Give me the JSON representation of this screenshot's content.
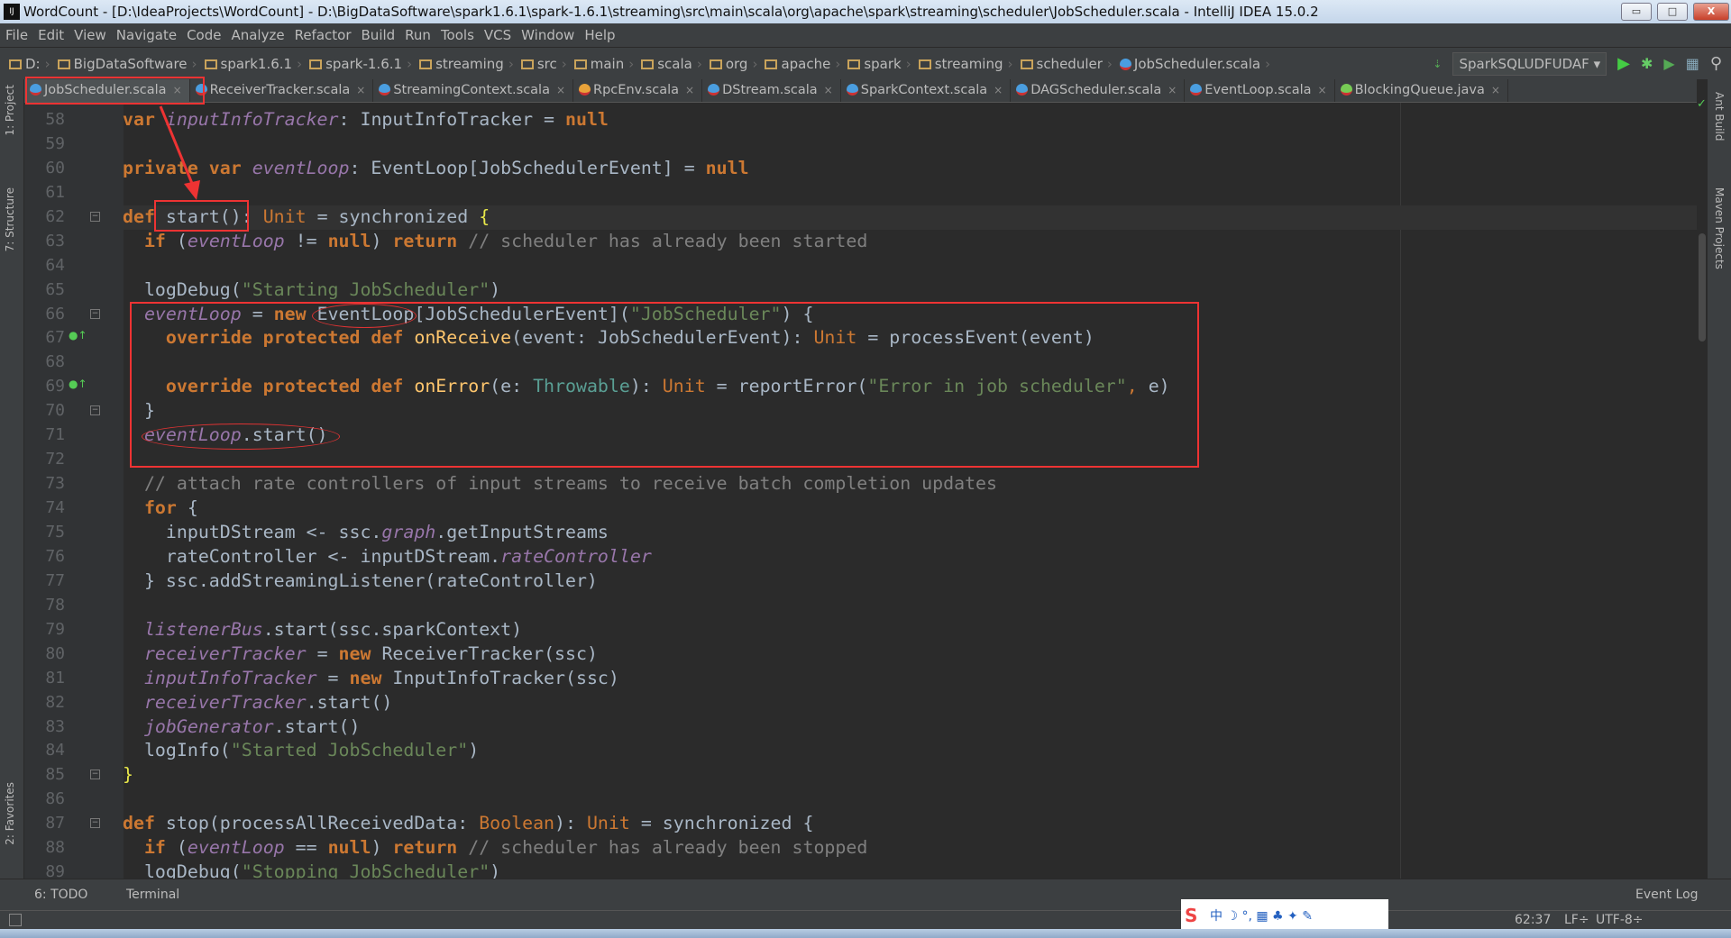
{
  "window": {
    "title": "WordCount - [D:\\IdeaProjects\\WordCount] - D:\\BigDataSoftware\\spark1.6.1\\spark-1.6.1\\streaming\\src\\main\\scala\\org\\apache\\spark\\streaming\\scheduler\\JobScheduler.scala - IntelliJ IDEA 15.0.2",
    "logo": "IJ",
    "minimize": "▭",
    "maximize": "□",
    "close": "X"
  },
  "menu": [
    "File",
    "Edit",
    "View",
    "Navigate",
    "Code",
    "Analyze",
    "Refactor",
    "Build",
    "Run",
    "Tools",
    "VCS",
    "Window",
    "Help"
  ],
  "breadcrumbs": [
    "D:",
    "BigDataSoftware",
    "spark1.6.1",
    "spark-1.6.1",
    "streaming",
    "src",
    "main",
    "scala",
    "org",
    "apache",
    "spark",
    "streaming",
    "scheduler",
    "JobScheduler.scala"
  ],
  "run_config": "SparkSQLUDFUDAF",
  "tabs": [
    {
      "label": "JobScheduler.scala",
      "active": true
    },
    {
      "label": "ReceiverTracker.scala"
    },
    {
      "label": "StreamingContext.scala"
    },
    {
      "label": "RpcEnv.scala"
    },
    {
      "label": "DStream.scala"
    },
    {
      "label": "SparkContext.scala"
    },
    {
      "label": "DAGScheduler.scala"
    },
    {
      "label": "EventLoop.scala"
    },
    {
      "label": "BlockingQueue.java"
    }
  ],
  "left_tools": [
    "1: Project",
    "7: Structure",
    "2: Favorites"
  ],
  "right_tools": [
    "Ant Build",
    "Maven Projects"
  ],
  "code": [
    {
      "n": "58",
      "t": [
        [
          "",
          "var ",
          "kw"
        ],
        [
          "inputInfoTracker",
          "fd"
        ],
        [
          ": InputInfoTracker = ",
          ""
        ],
        [
          "null",
          "kw"
        ]
      ]
    },
    {
      "n": "59",
      "t": []
    },
    {
      "n": "60",
      "t": [
        [
          "private var ",
          "kw"
        ],
        [
          "eventLoop",
          "fd"
        ],
        [
          ": EventLoop[JobSchedulerEvent] = ",
          ""
        ],
        [
          "null",
          "kw"
        ]
      ]
    },
    {
      "n": "61",
      "t": []
    },
    {
      "n": "62",
      "t": [
        [
          "def ",
          "kw"
        ],
        [
          "start",
          ""
        ],
        [
          "(): ",
          ""
        ],
        [
          "Unit",
          "ty"
        ],
        [
          " = synchronized ",
          ""
        ],
        [
          "{",
          "br"
        ]
      ]
    },
    {
      "n": "63",
      "t": [
        [
          "  if ",
          "kw"
        ],
        [
          "(",
          ""
        ],
        [
          "eventLoop",
          "fd"
        ],
        [
          " != ",
          ""
        ],
        [
          "null",
          "kw"
        ],
        [
          ") ",
          ""
        ],
        [
          "return",
          "kw"
        ],
        [
          " // scheduler has already been started",
          "cm"
        ]
      ]
    },
    {
      "n": "64",
      "t": []
    },
    {
      "n": "65",
      "t": [
        [
          "  logDebug(",
          ""
        ],
        [
          "\"Starting JobScheduler\"",
          "st"
        ],
        [
          ")",
          ""
        ]
      ]
    },
    {
      "n": "66",
      "t": [
        [
          "  ",
          ""
        ],
        [
          "eventLoop",
          "fd"
        ],
        [
          " = ",
          ""
        ],
        [
          "new ",
          "kw"
        ],
        [
          "EventLoop[JobSchedulerEvent](",
          ""
        ],
        [
          "\"JobScheduler\"",
          "st"
        ],
        [
          ") {",
          ""
        ]
      ]
    },
    {
      "n": "67",
      "t": [
        [
          "    override protected def ",
          "kw"
        ],
        [
          "onReceive",
          "fn"
        ],
        [
          "(event: JobSchedulerEvent): ",
          ""
        ],
        [
          "Unit",
          "ty"
        ],
        [
          " = processEvent(event)",
          ""
        ]
      ]
    },
    {
      "n": "68",
      "t": []
    },
    {
      "n": "69",
      "t": [
        [
          "    override protected def ",
          "kw"
        ],
        [
          "onError",
          "fn"
        ],
        [
          "(e: ",
          ""
        ],
        [
          "Throwable",
          "tp"
        ],
        [
          "): ",
          ""
        ],
        [
          "Unit",
          "ty"
        ],
        [
          " = reportError(",
          ""
        ],
        [
          "\"Error in job scheduler\"",
          "st"
        ],
        [
          ", ",
          "ty"
        ],
        [
          "e)",
          ""
        ]
      ]
    },
    {
      "n": "70",
      "t": [
        [
          "  }",
          ""
        ]
      ]
    },
    {
      "n": "71",
      "t": [
        [
          "  ",
          ""
        ],
        [
          "eventLoop",
          "fd"
        ],
        [
          ".start()",
          ""
        ]
      ]
    },
    {
      "n": "72",
      "t": []
    },
    {
      "n": "73",
      "t": [
        [
          "  // attach rate controllers of input streams to receive batch completion updates",
          "cm"
        ]
      ]
    },
    {
      "n": "74",
      "t": [
        [
          "  for ",
          "kw"
        ],
        [
          "{",
          ""
        ]
      ]
    },
    {
      "n": "75",
      "t": [
        [
          "    inputDStream <- ssc.",
          ""
        ],
        [
          "graph",
          "fd"
        ],
        [
          ".getInputStreams",
          ""
        ]
      ]
    },
    {
      "n": "76",
      "t": [
        [
          "    rateController <- inputDStream.",
          ""
        ],
        [
          "rateController",
          "fd"
        ]
      ]
    },
    {
      "n": "77",
      "t": [
        [
          "  } ssc.addStreamingListener(rateController)",
          ""
        ]
      ]
    },
    {
      "n": "78",
      "t": []
    },
    {
      "n": "79",
      "t": [
        [
          "  ",
          ""
        ],
        [
          "listenerBus",
          "fd"
        ],
        [
          ".start(ssc.sparkContext)",
          ""
        ]
      ]
    },
    {
      "n": "80",
      "t": [
        [
          "  ",
          ""
        ],
        [
          "receiverTracker",
          "fd"
        ],
        [
          " = ",
          ""
        ],
        [
          "new ",
          "kw"
        ],
        [
          "ReceiverTracker(ssc)",
          ""
        ]
      ]
    },
    {
      "n": "81",
      "t": [
        [
          "  ",
          ""
        ],
        [
          "inputInfoTracker",
          "fd"
        ],
        [
          " = ",
          ""
        ],
        [
          "new ",
          "kw"
        ],
        [
          "InputInfoTracker(ssc)",
          ""
        ]
      ]
    },
    {
      "n": "82",
      "t": [
        [
          "  ",
          ""
        ],
        [
          "receiverTracker",
          "fd"
        ],
        [
          ".start()",
          ""
        ]
      ]
    },
    {
      "n": "83",
      "t": [
        [
          "  ",
          ""
        ],
        [
          "jobGenerator",
          "fd"
        ],
        [
          ".start()",
          ""
        ]
      ]
    },
    {
      "n": "84",
      "t": [
        [
          "  logInfo(",
          ""
        ],
        [
          "\"Started JobScheduler\"",
          "st"
        ],
        [
          ")",
          ""
        ]
      ]
    },
    {
      "n": "85",
      "t": [
        [
          "}",
          "br"
        ]
      ]
    },
    {
      "n": "86",
      "t": []
    },
    {
      "n": "87",
      "t": [
        [
          "def ",
          "kw"
        ],
        [
          "stop(processAllReceivedData: ",
          ""
        ],
        [
          "Boolean",
          "ty"
        ],
        [
          "): ",
          ""
        ],
        [
          "Unit",
          "ty"
        ],
        [
          " = synchronized {",
          ""
        ]
      ]
    },
    {
      "n": "88",
      "t": [
        [
          "  if ",
          "kw"
        ],
        [
          "(",
          ""
        ],
        [
          "eventLoop",
          "fd"
        ],
        [
          " == ",
          ""
        ],
        [
          "null",
          "kw"
        ],
        [
          ") ",
          ""
        ],
        [
          "return",
          "kw"
        ],
        [
          " // scheduler has already been stopped",
          "cm"
        ]
      ]
    },
    {
      "n": "89",
      "t": [
        [
          "  logDebug(",
          ""
        ],
        [
          "\"Stopping JobScheduler\"",
          "st"
        ],
        [
          ")",
          ""
        ]
      ]
    }
  ],
  "bottom_tools": {
    "todo": "6: TODO",
    "terminal": "Terminal",
    "event_log": "Event Log"
  },
  "status": {
    "position": "62:37",
    "line_sep": "LF÷",
    "encoding": "UTF-8÷"
  },
  "ime": "中 ☽ °, ▦ ♣ ✦ ✎"
}
